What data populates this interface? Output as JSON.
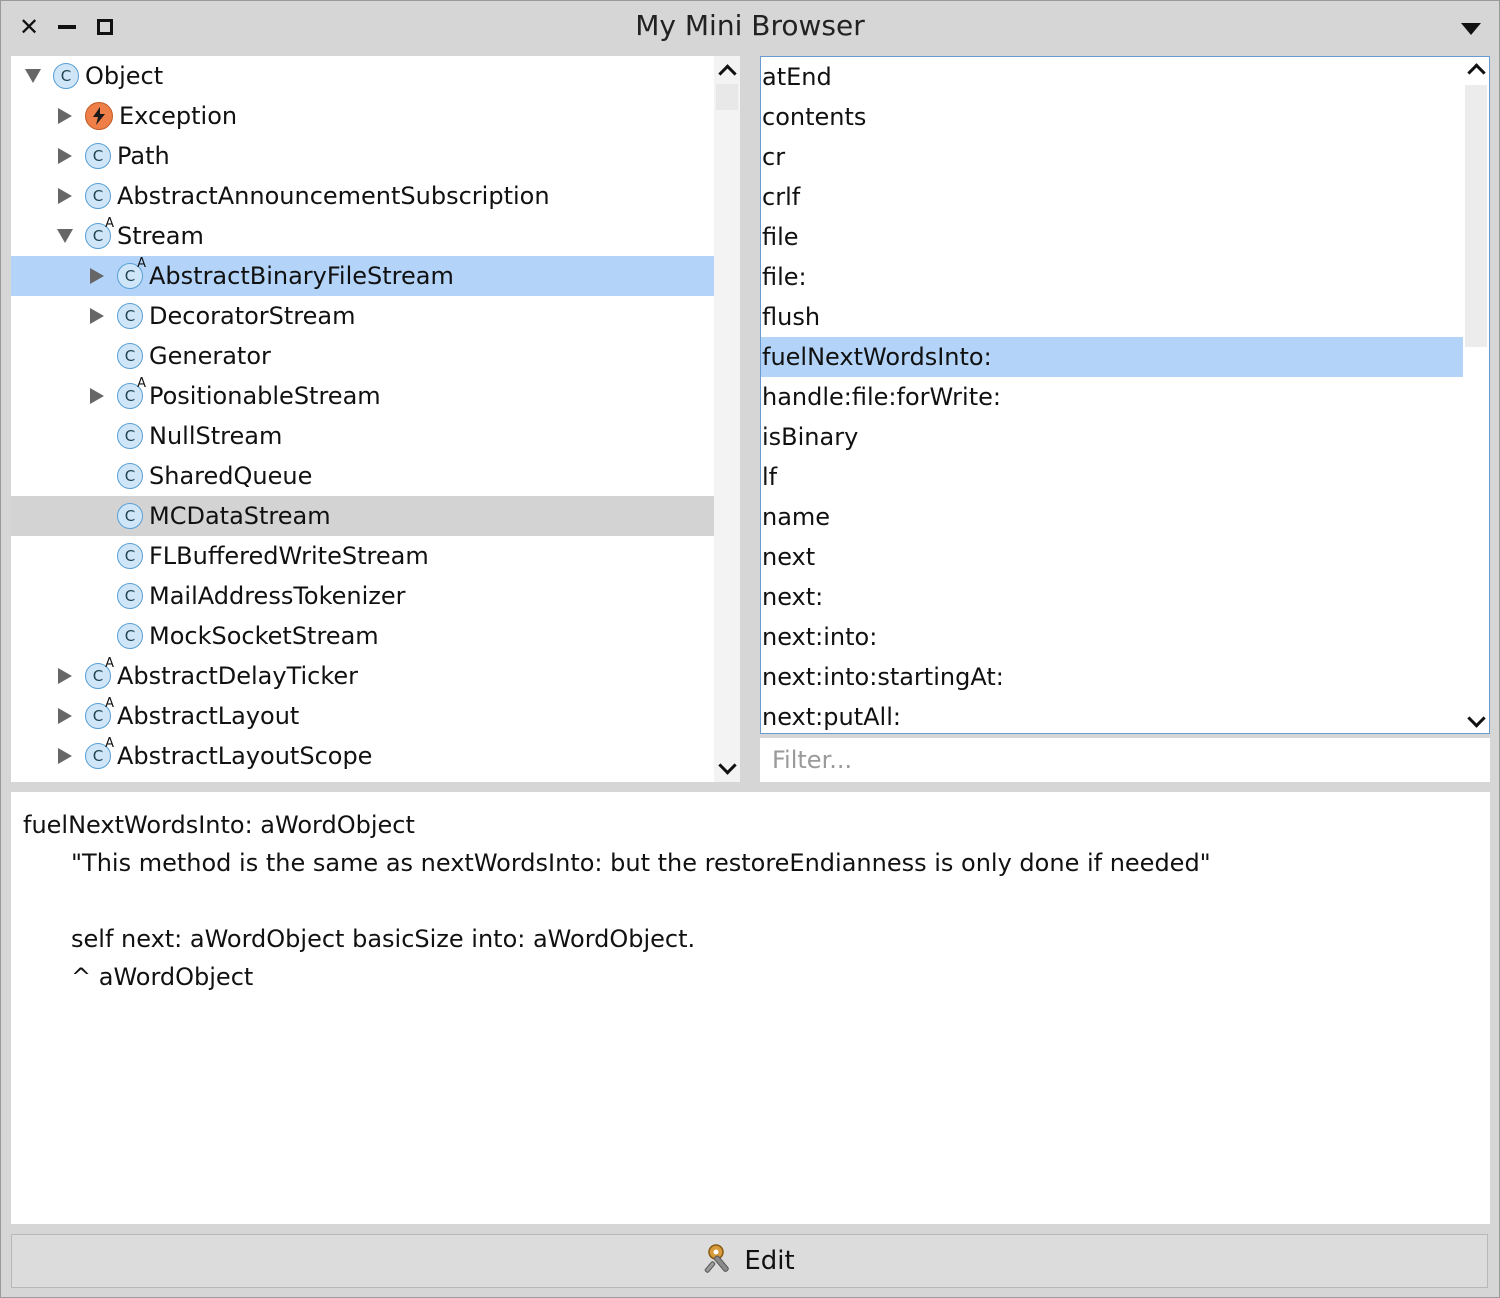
{
  "window": {
    "title": "My Mini Browser"
  },
  "tree": [
    {
      "label": "Object",
      "depth": 0,
      "toggle": "expanded",
      "icon": "class-icon",
      "abstract": false,
      "state": ""
    },
    {
      "label": "Exception",
      "depth": 1,
      "toggle": "collapsed",
      "icon": "exception-icon",
      "abstract": false,
      "state": ""
    },
    {
      "label": "Path",
      "depth": 1,
      "toggle": "collapsed",
      "icon": "class-icon",
      "abstract": false,
      "state": ""
    },
    {
      "label": "AbstractAnnouncementSubscription",
      "depth": 1,
      "toggle": "collapsed",
      "icon": "class-icon",
      "abstract": false,
      "state": ""
    },
    {
      "label": "Stream",
      "depth": 1,
      "toggle": "expanded",
      "icon": "class-icon",
      "abstract": true,
      "state": ""
    },
    {
      "label": "AbstractBinaryFileStream",
      "depth": 2,
      "toggle": "collapsed",
      "icon": "class-icon",
      "abstract": true,
      "state": "selected"
    },
    {
      "label": "DecoratorStream",
      "depth": 2,
      "toggle": "collapsed",
      "icon": "class-icon",
      "abstract": false,
      "state": ""
    },
    {
      "label": "Generator",
      "depth": 2,
      "toggle": "none",
      "icon": "class-icon",
      "abstract": false,
      "state": ""
    },
    {
      "label": "PositionableStream",
      "depth": 2,
      "toggle": "collapsed",
      "icon": "class-icon",
      "abstract": true,
      "state": ""
    },
    {
      "label": "NullStream",
      "depth": 2,
      "toggle": "none",
      "icon": "class-icon",
      "abstract": false,
      "state": ""
    },
    {
      "label": "SharedQueue",
      "depth": 2,
      "toggle": "none",
      "icon": "class-icon",
      "abstract": false,
      "state": ""
    },
    {
      "label": "MCDataStream",
      "depth": 2,
      "toggle": "none",
      "icon": "class-icon",
      "abstract": false,
      "state": "hovered"
    },
    {
      "label": "FLBufferedWriteStream",
      "depth": 2,
      "toggle": "none",
      "icon": "class-icon",
      "abstract": false,
      "state": ""
    },
    {
      "label": "MailAddressTokenizer",
      "depth": 2,
      "toggle": "none",
      "icon": "class-icon",
      "abstract": false,
      "state": ""
    },
    {
      "label": "MockSocketStream",
      "depth": 2,
      "toggle": "none",
      "icon": "class-icon",
      "abstract": false,
      "state": ""
    },
    {
      "label": "AbstractDelayTicker",
      "depth": 1,
      "toggle": "collapsed",
      "icon": "class-icon",
      "abstract": true,
      "state": ""
    },
    {
      "label": "AbstractLayout",
      "depth": 1,
      "toggle": "collapsed",
      "icon": "class-icon",
      "abstract": true,
      "state": ""
    },
    {
      "label": "AbstractLayoutScope",
      "depth": 1,
      "toggle": "collapsed",
      "icon": "class-icon",
      "abstract": true,
      "state": ""
    }
  ],
  "class_icon_letter": "C",
  "abstract_marker": "A",
  "methods": [
    {
      "label": "atEnd",
      "selected": false
    },
    {
      "label": "contents",
      "selected": false
    },
    {
      "label": "cr",
      "selected": false
    },
    {
      "label": "crlf",
      "selected": false
    },
    {
      "label": "file",
      "selected": false
    },
    {
      "label": "file:",
      "selected": false
    },
    {
      "label": "flush",
      "selected": false
    },
    {
      "label": "fuelNextWordsInto:",
      "selected": true
    },
    {
      "label": "handle:file:forWrite:",
      "selected": false
    },
    {
      "label": "isBinary",
      "selected": false
    },
    {
      "label": "lf",
      "selected": false
    },
    {
      "label": "name",
      "selected": false
    },
    {
      "label": "next",
      "selected": false
    },
    {
      "label": "next:",
      "selected": false
    },
    {
      "label": "next:into:",
      "selected": false
    },
    {
      "label": "next:into:startingAt:",
      "selected": false
    },
    {
      "label": "next:putAll:",
      "selected": false
    }
  ],
  "filter": {
    "placeholder": "Filter..."
  },
  "code": {
    "lines": [
      {
        "text": "fuelNextWordsInto: aWordObject",
        "indent": false
      },
      {
        "text": "\"This method is the same as nextWordsInto: but the restoreEndianness is only done if needed\"",
        "indent": true
      },
      {
        "text": "",
        "indent": true
      },
      {
        "text": "self next: aWordObject basicSize into: aWordObject.",
        "indent": true
      },
      {
        "text": "^ aWordObject",
        "indent": true
      }
    ]
  },
  "toolbar": {
    "edit_label": "Edit"
  },
  "colors": {
    "selection": "#b3d4f8",
    "hover": "#d3d3d3",
    "exception_icon": "#ef7f49",
    "class_icon": "#cfe6f8"
  }
}
